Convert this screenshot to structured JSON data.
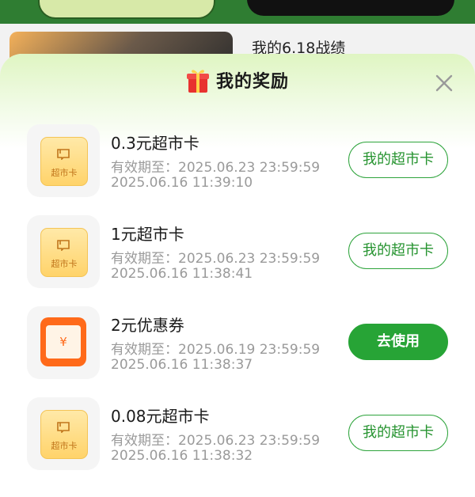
{
  "background": {
    "heading": "我的6.18战绩"
  },
  "sheet": {
    "title": "我的奖励",
    "close_icon": "close-icon",
    "gift_icon": "gift-icon"
  },
  "colors": {
    "accent_green": "#27a436",
    "coupon_orange": "#ff6a1a",
    "card_yellow": "#ffd36a"
  },
  "rewards": [
    {
      "name": "0.3元超市卡",
      "valid": "有效期至：2025.06.23 23:59:59",
      "issued": "2025.06.16 11:39:10",
      "icon": "supermarket-card-icon",
      "icon_label": "超市卡",
      "action": "我的超市卡",
      "action_style": "outline"
    },
    {
      "name": "1元超市卡",
      "valid": "有效期至：2025.06.23 23:59:59",
      "issued": "2025.06.16 11:38:41",
      "icon": "supermarket-card-icon",
      "icon_label": "超市卡",
      "action": "我的超市卡",
      "action_style": "outline"
    },
    {
      "name": "2元优惠券",
      "valid": "有效期至：2025.06.19 23:59:59",
      "issued": "2025.06.16 11:38:37",
      "icon": "coupon-icon",
      "icon_label": "¥",
      "action": "去使用",
      "action_style": "solid"
    },
    {
      "name": "0.08元超市卡",
      "valid": "有效期至：2025.06.23 23:59:59",
      "issued": "2025.06.16 11:38:32",
      "icon": "supermarket-card-icon",
      "icon_label": "超市卡",
      "action": "我的超市卡",
      "action_style": "outline"
    }
  ]
}
